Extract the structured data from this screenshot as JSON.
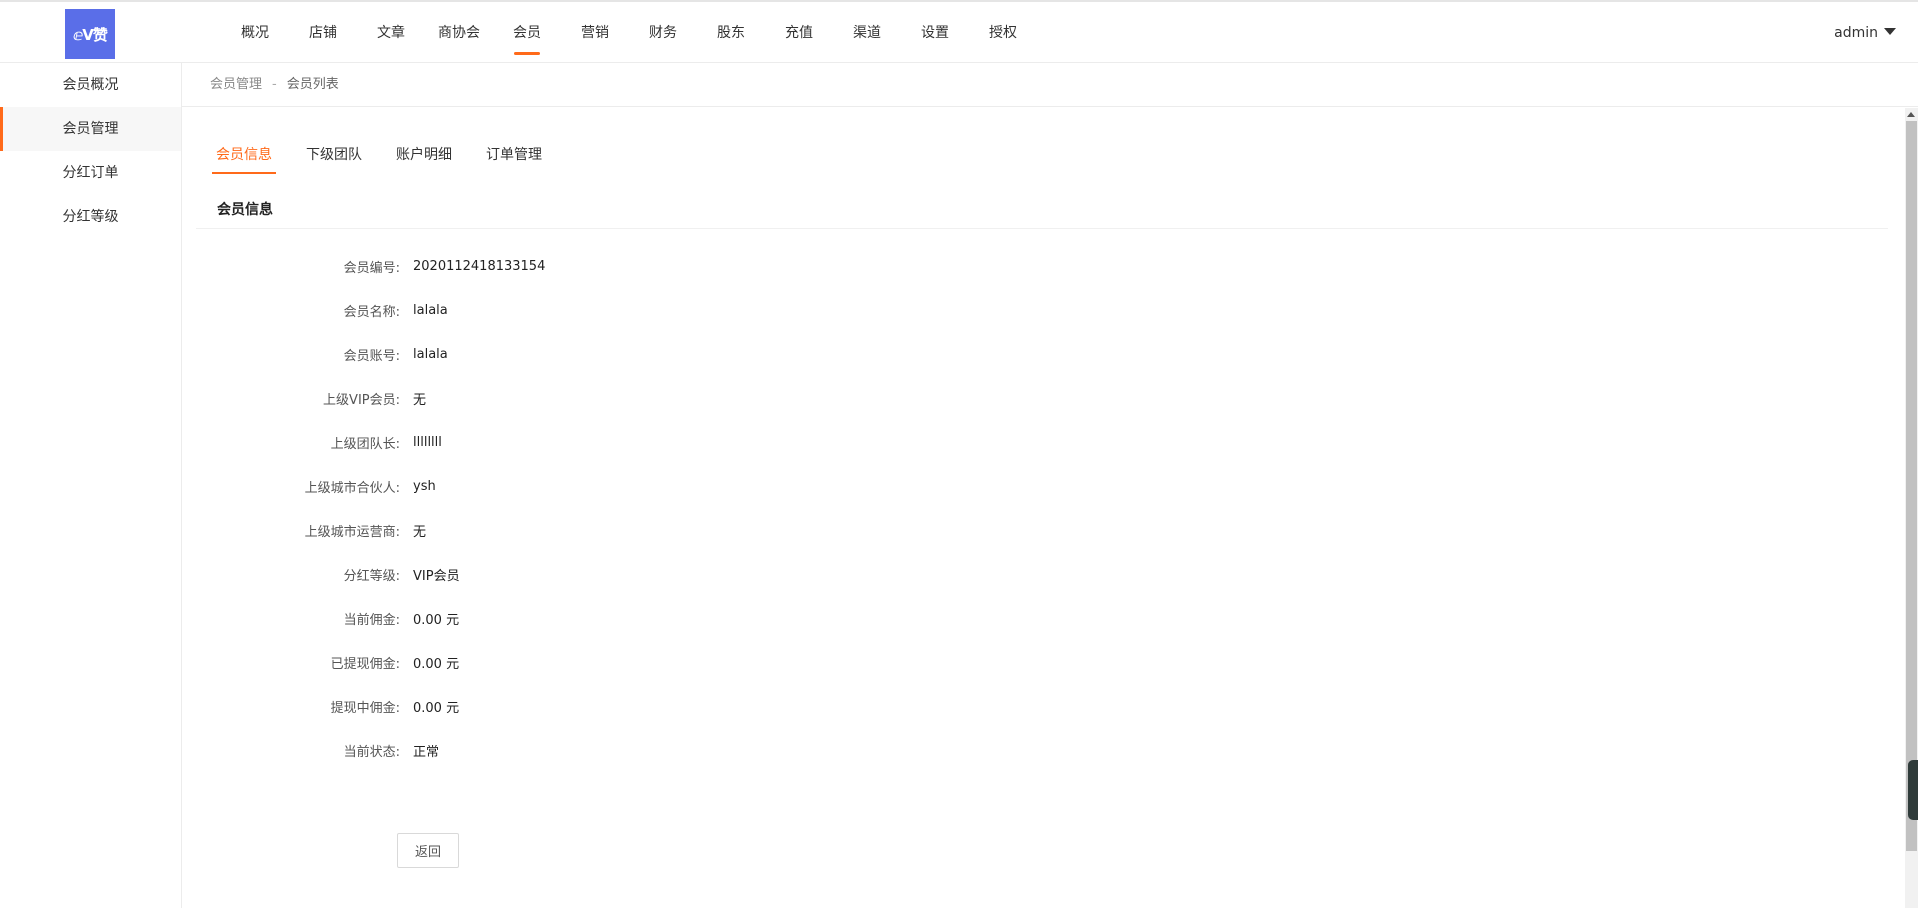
{
  "app": {
    "logo_text": "ⅇV赞"
  },
  "topnav": {
    "items": [
      "概况",
      "店铺",
      "文章",
      "商协会",
      "会员",
      "营销",
      "财务",
      "股东",
      "充值",
      "渠道",
      "设置",
      "授权"
    ],
    "active_index": 4
  },
  "user": {
    "name": "admin"
  },
  "sidebar": {
    "items": [
      "会员概况",
      "会员管理",
      "分红订单",
      "分红等级"
    ],
    "active_index": 1
  },
  "breadcrumb": {
    "parent": "会员管理",
    "separator": "-",
    "current": "会员列表"
  },
  "tabs": {
    "items": [
      "会员信息",
      "下级团队",
      "账户明细",
      "订单管理"
    ],
    "active_index": 0
  },
  "section": {
    "title": "会员信息"
  },
  "member": {
    "rows": [
      {
        "label": "会员编号:",
        "value": "2020112418133154"
      },
      {
        "label": "会员名称:",
        "value": "lalala"
      },
      {
        "label": "会员账号:",
        "value": "lalala"
      },
      {
        "label": "上级VIP会员:",
        "value": "无"
      },
      {
        "label": "上级团队长:",
        "value": "llllllll"
      },
      {
        "label": "上级城市合伙人:",
        "value": "ysh"
      },
      {
        "label": "上级城市运营商:",
        "value": "无"
      },
      {
        "label": "分红等级:",
        "value": "VIP会员"
      },
      {
        "label": "当前佣金:",
        "value": "0.00 元"
      },
      {
        "label": "已提现佣金:",
        "value": "0.00 元"
      },
      {
        "label": "提现中佣金:",
        "value": "0.00 元"
      },
      {
        "label": "当前状态:",
        "value": "正常"
      }
    ]
  },
  "actions": {
    "back_label": "返回"
  },
  "colors": {
    "accent": "#ff6a1a",
    "logo_bg": "#5a6ee8"
  }
}
